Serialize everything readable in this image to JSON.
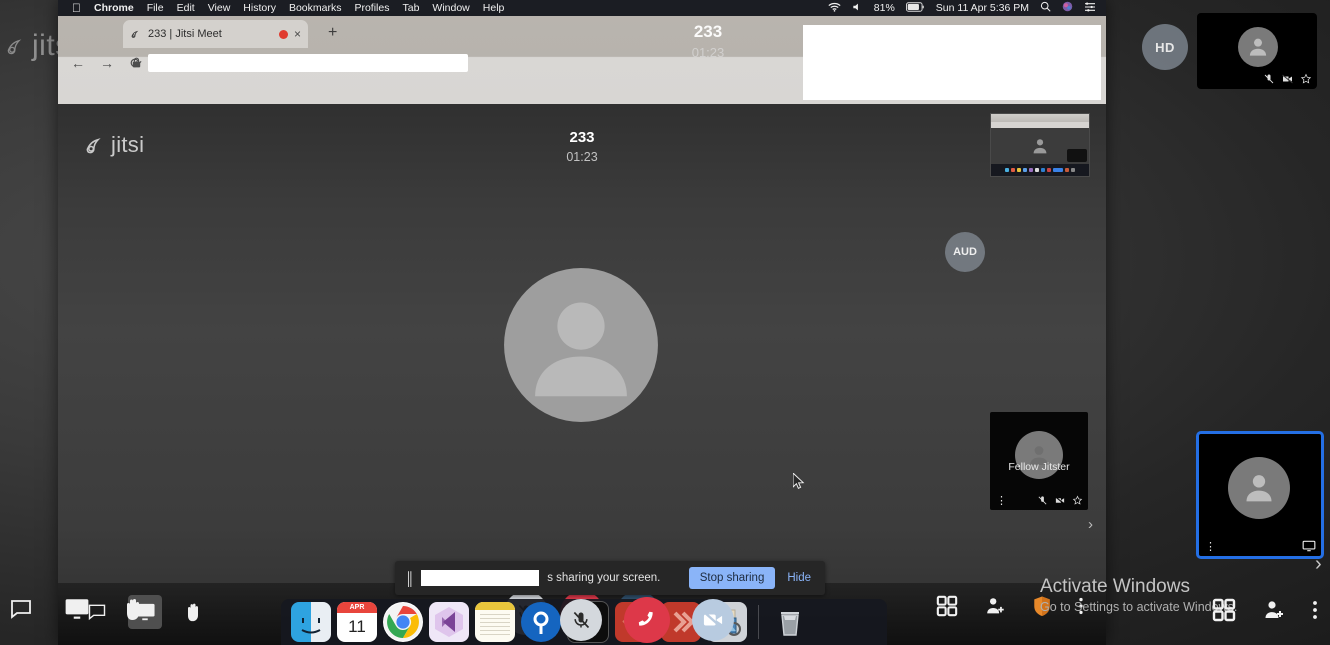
{
  "outer_desktop": {
    "brand": "jitsi",
    "hd_badge": "HD",
    "filmstrip_arrow": "›",
    "toolbar_icons": [
      "chat-icon",
      "screen-share-icon",
      "raise-hand-icon"
    ],
    "right_icons": [
      "tile-view-icon",
      "invite-people-icon",
      "more-options-icon"
    ],
    "thumbnails": [
      {
        "name": "",
        "icons": [
          "mic-muted-icon",
          "camera-off-icon",
          "star-icon"
        ],
        "selected": false
      },
      {
        "name": "",
        "icons": [
          "screen-share-icon"
        ],
        "selected": true
      }
    ]
  },
  "activate_windows": {
    "title": "Activate Windows",
    "subtitle": "Go to Settings to activate Windows."
  },
  "mac_menubar": {
    "apple": "",
    "app_name": "Chrome",
    "menus": [
      "File",
      "Edit",
      "View",
      "History",
      "Bookmarks",
      "Profiles",
      "Tab",
      "Window",
      "Help"
    ],
    "status": {
      "wifi": "wifi-icon",
      "volume": "volume-icon",
      "battery_percent": "81%",
      "battery": "battery-icon",
      "datetime": "Sun 11 Apr  5:36 PM",
      "search": "spotlight-search-icon",
      "siri": "siri-icon",
      "control_center": "control-center-icon"
    }
  },
  "browser": {
    "tab": {
      "favicon": "jitsi-favicon",
      "title": "233 | Jitsi Meet",
      "recording_indicator": "recording-dot-icon",
      "close": "×"
    },
    "new_tab": "+",
    "nav": {
      "back": "←",
      "forward": "→",
      "reload": "⟳"
    },
    "address_bar": {
      "value": "",
      "placeholder": "",
      "lock": "lock-icon"
    }
  },
  "ghost_overlay": {
    "room": "233",
    "timer": "01:23"
  },
  "jitsi": {
    "brand": "jitsi",
    "room": "233",
    "timer": "01:23",
    "aud_badge": "AUD",
    "filmstrip_arrow": "›",
    "participant_tile": {
      "name": "Fellow Jitster",
      "kebab": "⋮",
      "icons": [
        "mic-muted-icon",
        "camera-off-icon",
        "star-icon"
      ]
    },
    "toolbar_left": [
      {
        "name": "chat-icon",
        "label": "Chat",
        "active": false
      },
      {
        "name": "screen-share-icon",
        "label": "Share your screen",
        "active": true
      },
      {
        "name": "raise-hand-icon",
        "label": "Raise your hand",
        "active": false
      }
    ],
    "toolbar_center": [
      {
        "name": "mic-muted-icon",
        "label": "Unmute",
        "style": "grey"
      },
      {
        "name": "hangup-icon",
        "label": "Leave the meeting",
        "style": "red"
      },
      {
        "name": "camera-off-icon",
        "label": "Start camera",
        "style": "blue"
      }
    ],
    "toolbar_right": [
      {
        "name": "tile-view-icon",
        "label": "Toggle tile view"
      },
      {
        "name": "invite-people-icon",
        "label": "Invite people"
      },
      {
        "name": "security-shield-icon",
        "label": "Security options"
      },
      {
        "name": "more-options-icon",
        "label": "More actions"
      }
    ]
  },
  "share_bar": {
    "pause_icon": "pause-icon",
    "redacted_name": "",
    "message": "s sharing your screen.",
    "stop_label": "Stop sharing",
    "hide_label": "Hide"
  },
  "mac_dock": {
    "items": [
      {
        "name": "finder-icon",
        "label": "Finder"
      },
      {
        "name": "calendar-icon",
        "label": "Calendar",
        "month": "APR",
        "day": "11"
      },
      {
        "name": "chrome-icon",
        "label": "Google Chrome"
      },
      {
        "name": "vscode-icon",
        "label": "Visual Studio Code"
      },
      {
        "name": "notes-icon",
        "label": "Notes"
      },
      {
        "name": "postman-icon",
        "label": "Postman"
      },
      {
        "name": "terminal-icon",
        "label": "Terminal"
      },
      {
        "name": "sourcetree-icon",
        "label": "Sourcetree"
      },
      {
        "name": "sketch-icon",
        "label": "Sketch"
      },
      {
        "name": "preview-icon",
        "label": "Preview"
      },
      {
        "name": "trash-icon",
        "label": "Trash"
      }
    ]
  },
  "colors": {
    "accent_blue": "#246fe5",
    "chrome_blue": "#8ab4f8",
    "hangup_red": "#dd3849",
    "shield_orange": "#e8892a",
    "recording_red": "#e03b2f"
  }
}
